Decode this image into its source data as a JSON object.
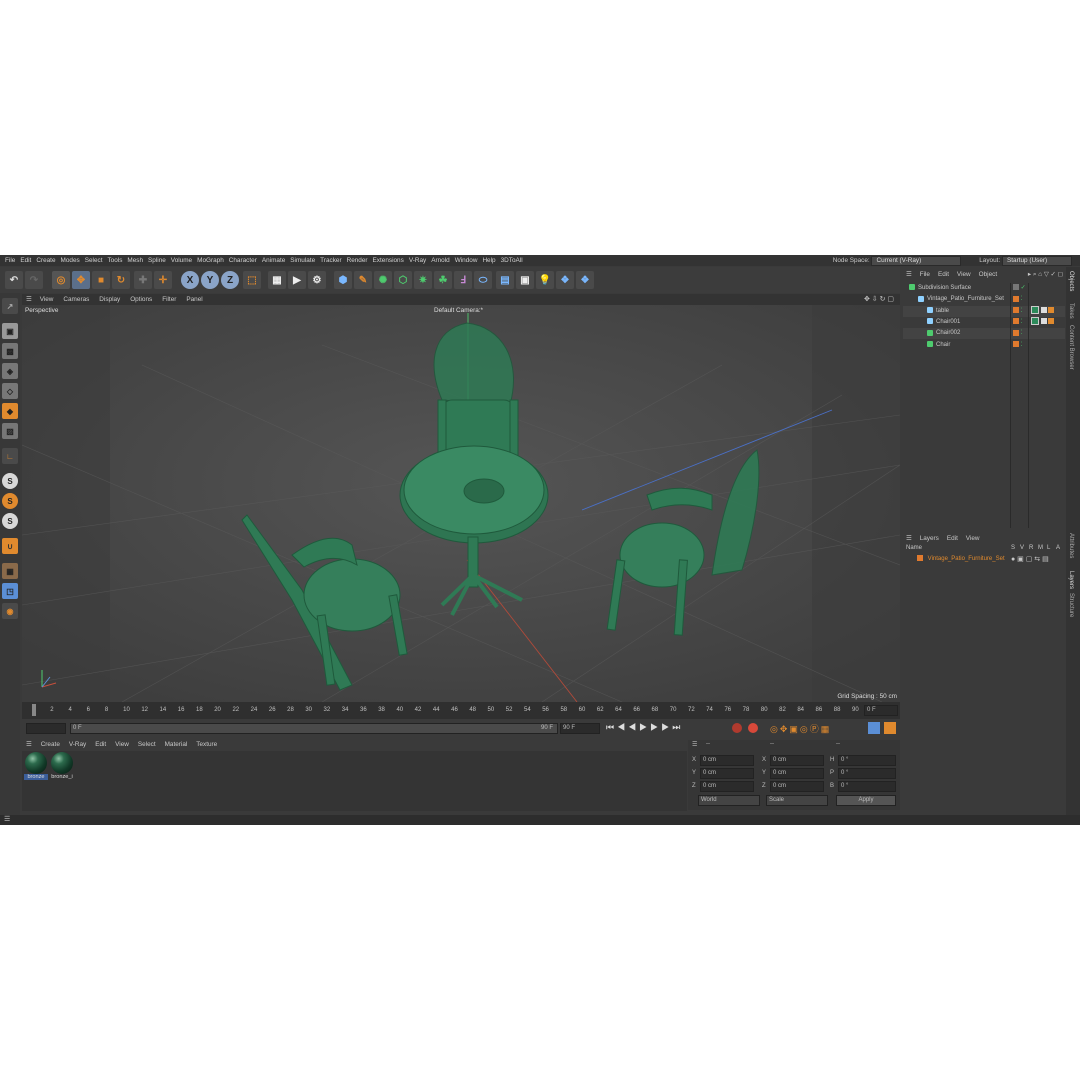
{
  "menubar": {
    "items": [
      "File",
      "Edit",
      "Create",
      "Modes",
      "Select",
      "Tools",
      "Mesh",
      "Spline",
      "Volume",
      "MoGraph",
      "Character",
      "Animate",
      "Simulate",
      "Tracker",
      "Render",
      "Extensions",
      "V-Ray",
      "Arnold",
      "Window",
      "Help",
      "3DToAll"
    ],
    "node_space_label": "Node Space:",
    "node_space_value": "Current (V-Ray)",
    "layout_label": "Layout:",
    "layout_value": "Startup (User)"
  },
  "toolbar": {
    "axis_x": "X",
    "axis_y": "Y",
    "axis_z": "Z"
  },
  "left_tools": {
    "s1": "S",
    "s2": "S",
    "s3": "S"
  },
  "viewport": {
    "menu": [
      "View",
      "Cameras",
      "Display",
      "Options",
      "Filter",
      "Panel"
    ],
    "name": "Perspective",
    "camera": "Default Camera:*",
    "grid_spacing": "Grid Spacing : 50 cm"
  },
  "timeline": {
    "ticks": [
      "0",
      "2",
      "4",
      "6",
      "8",
      "10",
      "12",
      "14",
      "16",
      "18",
      "20",
      "22",
      "24",
      "26",
      "28",
      "30",
      "32",
      "34",
      "36",
      "38",
      "40",
      "42",
      "44",
      "46",
      "48",
      "50",
      "52",
      "54",
      "56",
      "58",
      "60",
      "62",
      "64",
      "66",
      "68",
      "70",
      "72",
      "74",
      "76",
      "78",
      "80",
      "82",
      "84",
      "86",
      "88",
      "90"
    ],
    "end_label": "0 F"
  },
  "playbar": {
    "start_frame": "0 F",
    "current_frame": "0 F",
    "end_frame_a": "90 F",
    "end_frame_b": "90 F"
  },
  "materials": {
    "menu": [
      "Create",
      "V-Ray",
      "Edit",
      "View",
      "Select",
      "Material",
      "Texture"
    ],
    "items": [
      {
        "name": "bronze"
      },
      {
        "name": "bronze_i"
      }
    ]
  },
  "coordinates": {
    "headers": [
      "--",
      "--",
      "--"
    ],
    "rows": [
      {
        "a": "X",
        "av": "0 cm",
        "b": "X",
        "bv": "0 cm",
        "c": "H",
        "cv": "0 °"
      },
      {
        "a": "Y",
        "av": "0 cm",
        "b": "Y",
        "bv": "0 cm",
        "c": "P",
        "cv": "0 °"
      },
      {
        "a": "Z",
        "av": "0 cm",
        "b": "Z",
        "bv": "0 cm",
        "c": "B",
        "cv": "0 °"
      }
    ],
    "mode_world": "World",
    "mode_scale": "Scale",
    "apply": "Apply"
  },
  "objects": {
    "menu": [
      "File",
      "Edit",
      "View",
      "Object"
    ],
    "tree": [
      {
        "name": "Subdivision Surface",
        "indent": 0,
        "color": "#4ecb6e"
      },
      {
        "name": "Vintage_Patio_Furniture_Set",
        "indent": 1,
        "color": "#8fd1ff"
      },
      {
        "name": "table",
        "indent": 2,
        "color": "#8fd1ff"
      },
      {
        "name": "Chair001",
        "indent": 2,
        "color": "#8fd1ff"
      },
      {
        "name": "Chair002",
        "indent": 2,
        "color": "#4ecb6e"
      },
      {
        "name": "Chair",
        "indent": 2,
        "color": "#4ecb6e"
      }
    ]
  },
  "layers": {
    "menu": [
      "Layers",
      "Edit",
      "View"
    ],
    "name_header": "Name",
    "cols": [
      "S",
      "V",
      "R",
      "M",
      "L",
      "A"
    ],
    "row_name": "Vintage_Patio_Furniture_Set",
    "row_color": "#e07a2e"
  },
  "vtabs": [
    "Objects",
    "Takes",
    "Content Browser",
    "Attributes",
    "Layers",
    "Structure"
  ],
  "colors": {
    "accent": "#e08a2e",
    "furniture": "#2f7a55",
    "selection": "#5b8fd6"
  }
}
